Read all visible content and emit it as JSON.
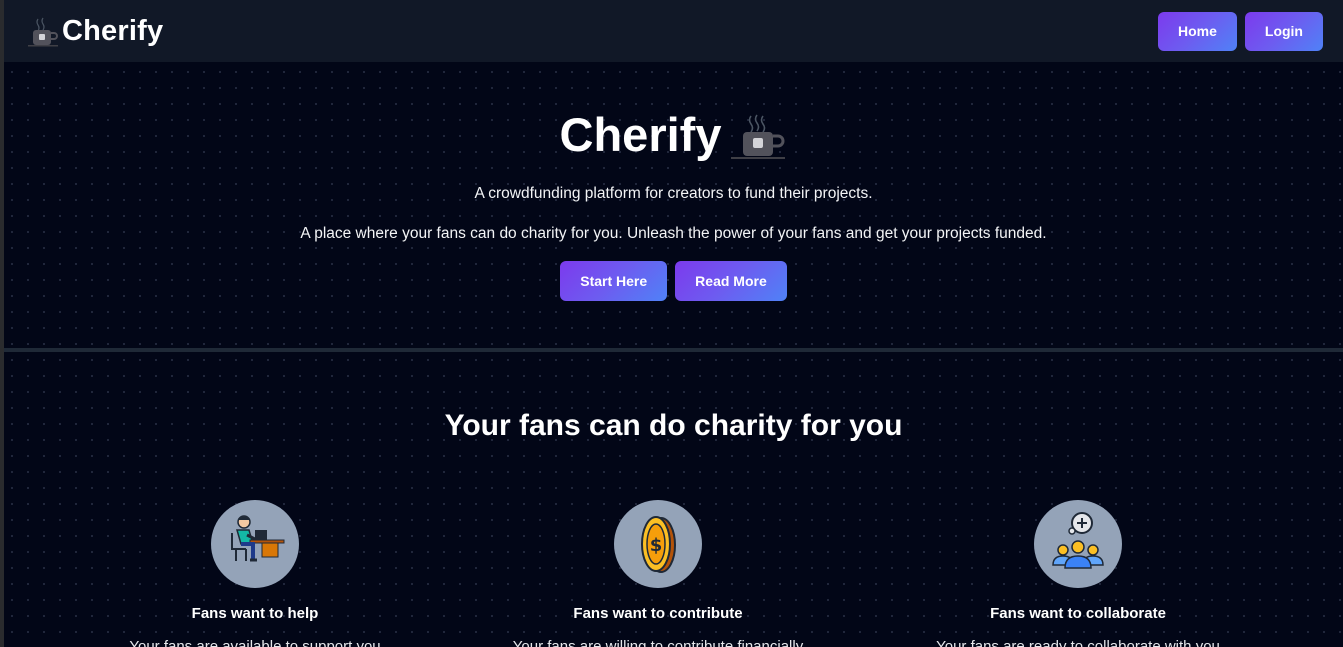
{
  "navbar": {
    "brand": "Cherify",
    "brand_icon": "coffee-mug-icon",
    "home_label": "Home",
    "login_label": "Login"
  },
  "hero": {
    "title": "Cherify",
    "line1": "A crowdfunding platform for creators to fund their projects.",
    "line2": "A place where your fans can do charity for you. Unleash the power of your fans and get your projects funded.",
    "start_label": "Start Here",
    "read_label": "Read More"
  },
  "features": {
    "title": "Your fans can do charity for you",
    "items": [
      {
        "icon": "person-at-desk-icon",
        "title": "Fans want to help",
        "desc": "Your fans are available to support you"
      },
      {
        "icon": "gold-coin-icon",
        "title": "Fans want to contribute",
        "desc": "Your fans are willing to contribute financially"
      },
      {
        "icon": "group-collaborate-icon",
        "title": "Fans want to collaborate",
        "desc": "Your fans are ready to collaborate with you"
      }
    ]
  },
  "colors": {
    "background": "#020617",
    "navbar": "#111827",
    "button_gradient_start": "#7c3aed",
    "button_gradient_end": "#4f82f7",
    "icon_circle": "#94a3b8"
  }
}
